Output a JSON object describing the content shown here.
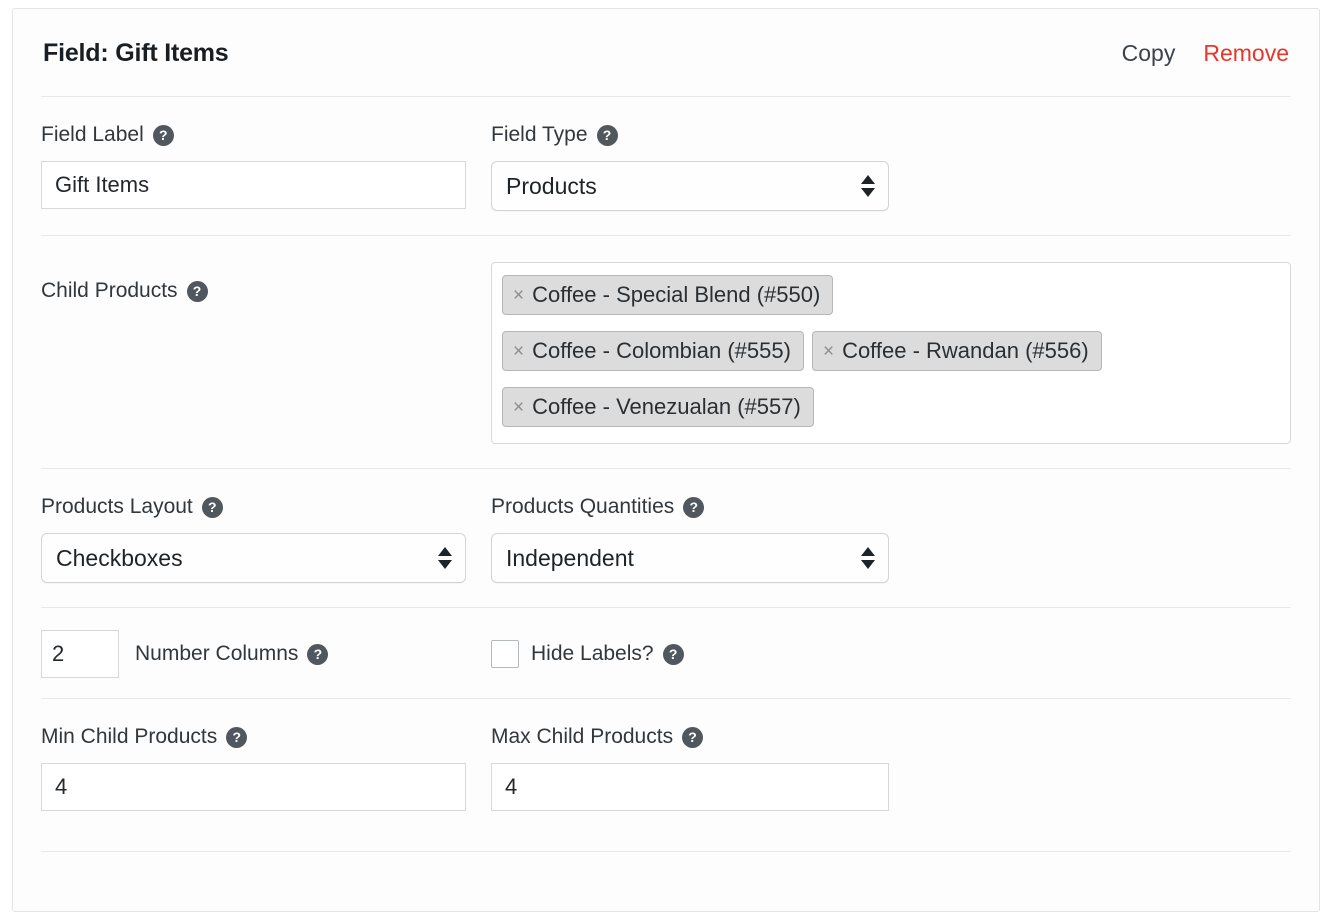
{
  "panel": {
    "title": "Field: Gift Items",
    "actions": {
      "copy": "Copy",
      "remove": "Remove"
    },
    "accent_remove_color": "#e8362a"
  },
  "help_icon_glyph": "?",
  "fields": {
    "field_label": {
      "label": "Field Label",
      "value": "Gift Items",
      "placeholder": ""
    },
    "field_type": {
      "label": "Field Type",
      "value": "Products"
    },
    "child_products": {
      "label": "Child Products",
      "tokens": [
        {
          "remove_glyph": "×",
          "text": "Coffee - Special Blend (#550)"
        },
        {
          "remove_glyph": "×",
          "text": "Coffee - Colombian (#555)"
        },
        {
          "remove_glyph": "×",
          "text": "Coffee - Rwandan (#556)"
        },
        {
          "remove_glyph": "×",
          "text": "Coffee - Venezualan (#557)"
        }
      ]
    },
    "products_layout": {
      "label": "Products Layout",
      "value": "Checkboxes"
    },
    "products_quantities": {
      "label": "Products Quantities",
      "value": "Independent"
    },
    "number_columns": {
      "label": "Number Columns",
      "value": "2"
    },
    "hide_labels": {
      "label": "Hide Labels?",
      "checked": false
    },
    "min_child_products": {
      "label": "Min Child Products",
      "value": "4"
    },
    "max_child_products": {
      "label": "Max Child Products",
      "value": "4"
    }
  }
}
